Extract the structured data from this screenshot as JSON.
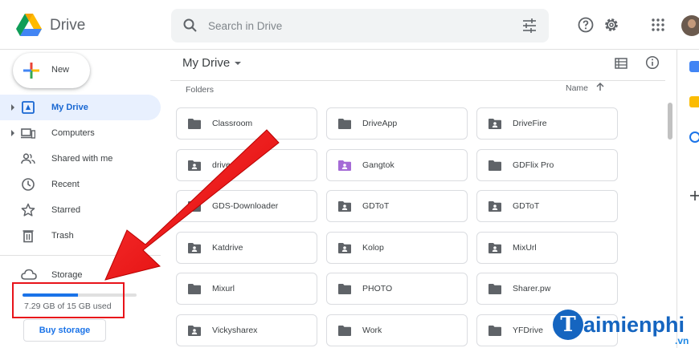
{
  "header": {
    "app_name": "Drive",
    "search_placeholder": "Search in Drive",
    "icons": [
      "drive-logo",
      "search-icon",
      "search-options-icon",
      "help-icon",
      "settings-icon",
      "apps-grid-icon",
      "avatar"
    ]
  },
  "sidebar": {
    "new_label": "New",
    "items": [
      {
        "label": "My Drive",
        "icon": "my-drive-icon",
        "active": true,
        "expandable": true
      },
      {
        "label": "Computers",
        "icon": "computers-icon",
        "active": false,
        "expandable": true
      },
      {
        "label": "Shared with me",
        "icon": "shared-icon",
        "active": false,
        "expandable": false
      },
      {
        "label": "Recent",
        "icon": "clock-icon",
        "active": false,
        "expandable": false
      },
      {
        "label": "Starred",
        "icon": "star-icon",
        "active": false,
        "expandable": false
      },
      {
        "label": "Trash",
        "icon": "trash-icon",
        "active": false,
        "expandable": false
      }
    ],
    "storage": {
      "label": "Storage",
      "used_text": "7.29 GB of 15 GB used",
      "used_fraction": 0.486,
      "buy_label": "Buy storage"
    }
  },
  "main": {
    "breadcrumb": "My Drive",
    "section_label": "Folders",
    "sort_label": "Name",
    "folders": [
      {
        "name": "Classroom",
        "shared": false
      },
      {
        "name": "DriveApp",
        "shared": false
      },
      {
        "name": "DriveFire",
        "shared": true
      },
      {
        "name": "drive•us",
        "shared": true
      },
      {
        "name": "Gangtok",
        "shared": true,
        "color": "#a56bd6"
      },
      {
        "name": "GDFlix Pro",
        "shared": false
      },
      {
        "name": "GDS-Downloader",
        "shared": false
      },
      {
        "name": "GDToT",
        "shared": true
      },
      {
        "name": "GDToT",
        "shared": true
      },
      {
        "name": "Katdrive",
        "shared": true
      },
      {
        "name": "Kolop",
        "shared": true
      },
      {
        "name": "MixUrl",
        "shared": true
      },
      {
        "name": "Mixurl",
        "shared": false
      },
      {
        "name": "PHOTO",
        "shared": false
      },
      {
        "name": "Sharer.pw",
        "shared": false
      },
      {
        "name": "Vickysharex",
        "shared": true
      },
      {
        "name": "Work",
        "shared": false
      },
      {
        "name": "YFDrive",
        "shared": false
      }
    ]
  },
  "watermark": {
    "letter": "T",
    "text": "aimienphi",
    "suffix": ".vn"
  },
  "colors": {
    "accent": "#1a73e8",
    "active_bg": "#e8f0fe",
    "highlight": "#e8131a",
    "folder_icon": "#5f6368"
  }
}
